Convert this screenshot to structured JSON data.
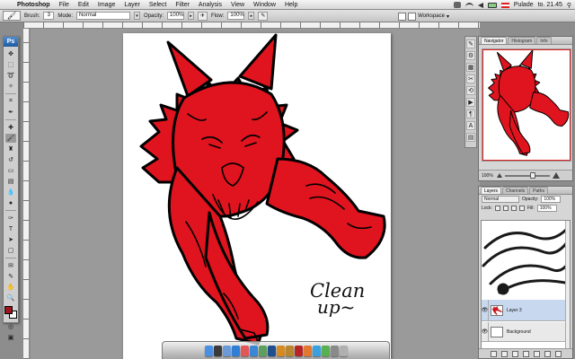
{
  "menubar": {
    "app_name": "Photoshop",
    "items": [
      "File",
      "Edit",
      "Image",
      "Layer",
      "Select",
      "Filter",
      "Analysis",
      "View",
      "Window",
      "Help"
    ],
    "user": "Pulade",
    "clock": "to. 21.45"
  },
  "options_bar": {
    "brush_label": "Brush:",
    "brush_size": "3",
    "mode_label": "Mode:",
    "mode_value": "Normal",
    "opacity_label": "Opacity:",
    "opacity_value": "100%",
    "flow_label": "Flow:",
    "flow_value": "100%",
    "workspace_label": "Workspace"
  },
  "toolbox": {
    "logo": "Ps",
    "tools": [
      "move-icon",
      "marquee-icon",
      "lasso-icon",
      "magic-wand-icon",
      "crop-icon",
      "eyedropper-icon",
      "healing-icon",
      "brush-icon",
      "clone-stamp-icon",
      "history-brush-icon",
      "eraser-icon",
      "gradient-icon",
      "blur-icon",
      "dodge-icon",
      "pen-icon",
      "type-icon",
      "path-select-icon",
      "shape-icon",
      "notes-icon",
      "hand-icon",
      "zoom-icon"
    ],
    "active_tool": "brush-icon",
    "foreground_color": "#a0141c",
    "background_color": "#ffffff"
  },
  "canvas": {
    "caption_line1": "Clean",
    "caption_line2": "up~",
    "fill_color": "#e0141e"
  },
  "navigator": {
    "tabs": [
      "Navigator",
      "Histogram",
      "Info"
    ],
    "zoom": "100%"
  },
  "layers": {
    "tabs": [
      "Layers",
      "Channels",
      "Paths"
    ],
    "blend_mode": "Normal",
    "opacity_label": "Opacity:",
    "opacity_value": "100%",
    "lock_label": "Lock:",
    "fill_label": "Fill:",
    "fill_value": "100%",
    "items": [
      {
        "name": "Layer 3",
        "selected": true
      },
      {
        "name": "Background",
        "selected": false
      }
    ]
  },
  "dock": {
    "icons": [
      "finder",
      "dashboard",
      "mail",
      "safari",
      "ical",
      "itunes",
      "iphoto",
      "photoshop",
      "illustrator",
      "bridge",
      "flash",
      "firefox",
      "skype",
      "msn",
      "prefs",
      "trash"
    ]
  }
}
